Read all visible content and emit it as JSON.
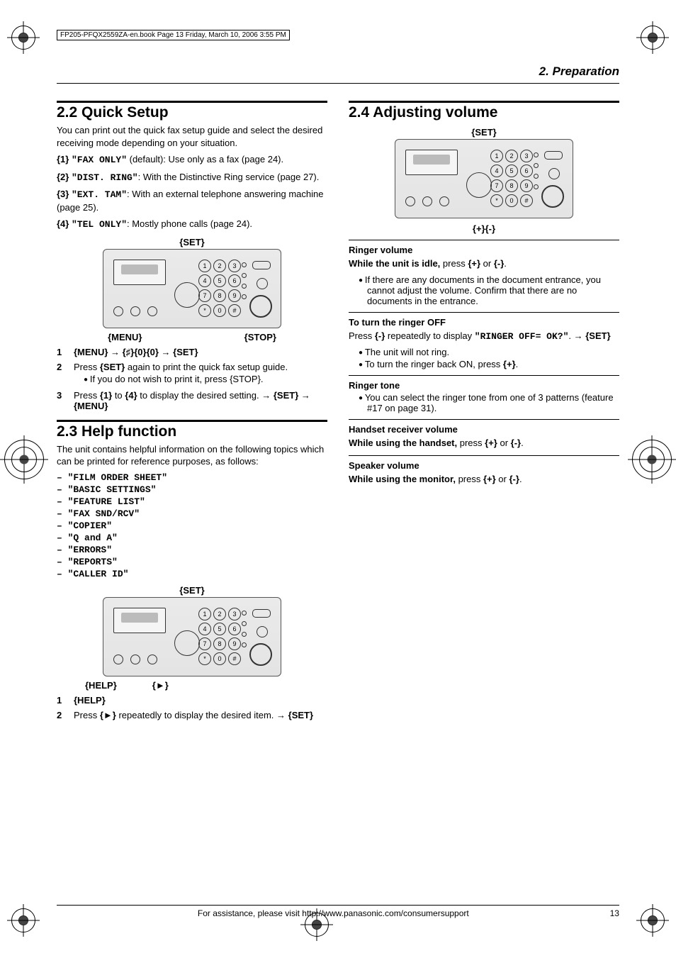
{
  "header_note": "FP205-PFQX2559ZA-en.book  Page 13  Friday, March 10, 2006  3:55 PM",
  "chapter": "2. Preparation",
  "page_number": "13",
  "footer": "For assistance, please visit http://www.panasonic.com/consumersupport",
  "s22": {
    "title": "2.2 Quick Setup",
    "intro": "You can print out the quick fax setup guide and select the desired receiving mode depending on your situation.",
    "opts": [
      {
        "k": "{1}",
        "code": "\"FAX ONLY\"",
        "rest": " (default): Use only as a fax (page 24)."
      },
      {
        "k": "{2}",
        "code": "\"DIST. RING\"",
        "rest": ": With the Distinctive Ring service (page 27)."
      },
      {
        "k": "{3}",
        "code": "\"EXT. TAM\"",
        "rest": ": With an external telephone answering machine (page 25)."
      },
      {
        "k": "{4}",
        "code": "\"TEL ONLY\"",
        "rest": ": Mostly phone calls (page 24)."
      }
    ],
    "panel_top": "{SET}",
    "panel_bot_left": "{MENU}",
    "panel_bot_right": "{STOP}",
    "steps": [
      {
        "n": "1",
        "html": "{MENU} → {♯}{0}{0} → {SET}"
      },
      {
        "n": "2",
        "html": "Press {SET} again to print the quick fax setup guide.",
        "sub": "If you do not wish to print it, press {STOP}."
      },
      {
        "n": "3",
        "html": "Press {1} to {4} to display the desired setting. → {SET} → {MENU}"
      }
    ]
  },
  "s23": {
    "title": "2.3 Help function",
    "intro": "The unit contains helpful information on the following topics which can be printed for reference purposes, as follows:",
    "items": [
      "\"FILM ORDER SHEET\"",
      "\"BASIC SETTINGS\"",
      "\"FEATURE LIST\"",
      "\"FAX SND/RCV\"",
      "\"COPIER\"",
      "\"Q and A\"",
      "\"ERRORS\"",
      "\"REPORTS\"",
      "\"CALLER ID\""
    ],
    "panel_top": "{SET}",
    "panel_bot_left": "{HELP}",
    "panel_bot_right": "{►}",
    "steps": [
      {
        "n": "1",
        "html": "{HELP}"
      },
      {
        "n": "2",
        "html": "Press {►} repeatedly to display the desired item. → {SET}"
      }
    ]
  },
  "s24": {
    "title": "2.4 Adjusting volume",
    "panel_top": "{SET}",
    "panel_bot": "{+}{-}",
    "ringer_vol_h": "Ringer volume",
    "ringer_vol_line": "While the unit is idle, press {+} or {-}.",
    "ringer_vol_sub": "If there are any documents in the document entrance, you cannot adjust the volume. Confirm that there are no documents in the entrance.",
    "ringer_off_h": "To turn the ringer OFF",
    "ringer_off_line": "Press {-} repeatedly to display \"RINGER OFF= OK?\". → {SET}",
    "ringer_off_b1": "The unit will not ring.",
    "ringer_off_b2": "To turn the ringer back ON, press {+}.",
    "tone_h": "Ringer tone",
    "tone_b": "You can select the ringer tone from one of 3 patterns (feature #17 on page 31).",
    "hand_h": "Handset receiver volume",
    "hand_line": "While using the handset, press {+} or {-}.",
    "spk_h": "Speaker volume",
    "spk_line": "While using the monitor, press {+} or {-}."
  }
}
